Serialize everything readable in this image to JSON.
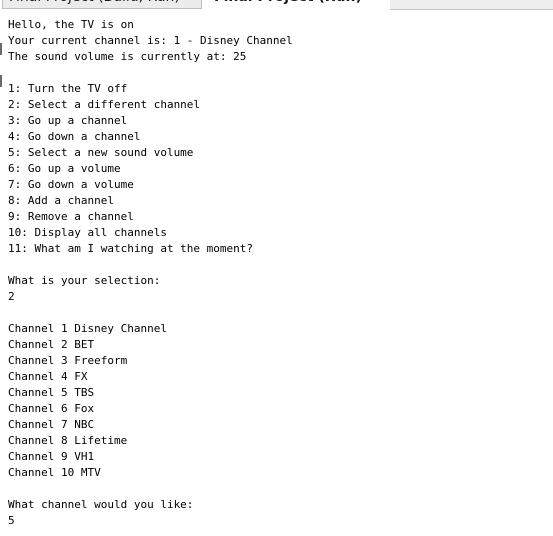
{
  "tabs": {
    "build_label": "Final Project (Build, Run)",
    "run_label": "Final Project (Run)"
  },
  "console_lines": [
    "Hello, the TV is on",
    "Your current channel is: 1 - Disney Channel",
    "The sound volume is currently at: 25",
    "",
    "1: Turn the TV off",
    "2: Select a different channel",
    "3: Go up a channel",
    "4: Go down a channel",
    "5: Select a new sound volume",
    "6: Go up a volume",
    "7: Go down a volume",
    "8: Add a channel",
    "9: Remove a channel",
    "10: Display all channels",
    "11: What am I watching at the moment?",
    "",
    "What is your selection:",
    "2",
    "",
    "Channel 1 Disney Channel",
    "Channel 2 BET",
    "Channel 3 Freeform",
    "Channel 4 FX",
    "Channel 5 TBS",
    "Channel 6 Fox",
    "Channel 7 NBC",
    "Channel 8 Lifetime",
    "Channel 9 VH1",
    "Channel 10 MTV",
    "",
    "What channel would you like:",
    "5"
  ]
}
